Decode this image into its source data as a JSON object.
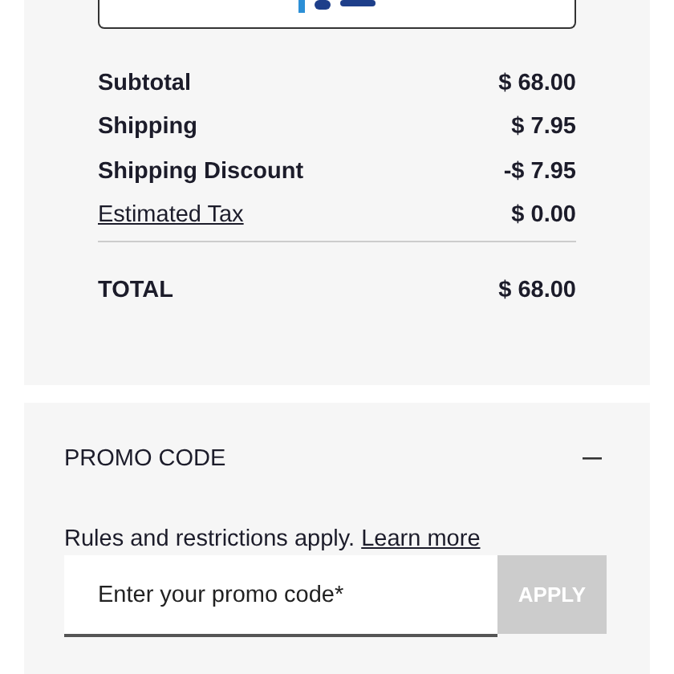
{
  "summary": {
    "rows": [
      {
        "kind": "plain",
        "label": "Subtotal",
        "value": "$ 68.00"
      },
      {
        "kind": "plain",
        "label": "Shipping",
        "value": "$ 7.95"
      },
      {
        "kind": "plain",
        "label": "Shipping Discount",
        "value": "-$ 7.95"
      },
      {
        "kind": "link",
        "label": "Estimated Tax",
        "value": "$ 0.00"
      }
    ],
    "total": {
      "label": "TOTAL",
      "value": "$ 68.00"
    }
  },
  "promo": {
    "title": "PROMO CODE",
    "expanded": true,
    "note": "Rules and restrictions apply.",
    "link": "Learn more",
    "field": {
      "placeholder": "Enter your promo code*"
    },
    "button": {
      "label": "APPLY",
      "disabled": true
    }
  }
}
